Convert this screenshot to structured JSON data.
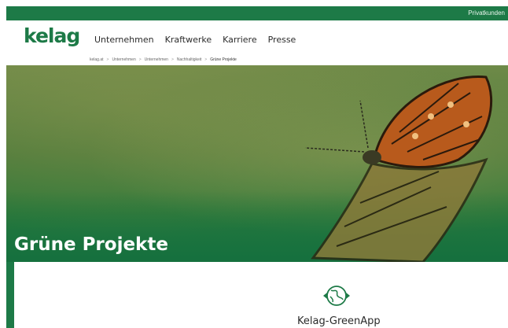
{
  "topbar": {
    "privatkunden_label": "Privatkunden"
  },
  "header": {
    "logo": "kelag",
    "nav": [
      "Unternehmen",
      "Kraftwerke",
      "Karriere",
      "Presse"
    ]
  },
  "breadcrumb": {
    "items": [
      "kelag.at",
      "Unternehmen",
      "Unternehmen",
      "Nachhaltigkeit",
      "Grüne Projekte"
    ],
    "separator": ">"
  },
  "hero": {
    "title": "Grüne Projekte"
  },
  "card": {
    "app_title": "Kelag-GreenApp"
  },
  "colors": {
    "brand_green": "#1d7a47"
  },
  "icons": {
    "app_icon": "globe-recycle-icon"
  }
}
